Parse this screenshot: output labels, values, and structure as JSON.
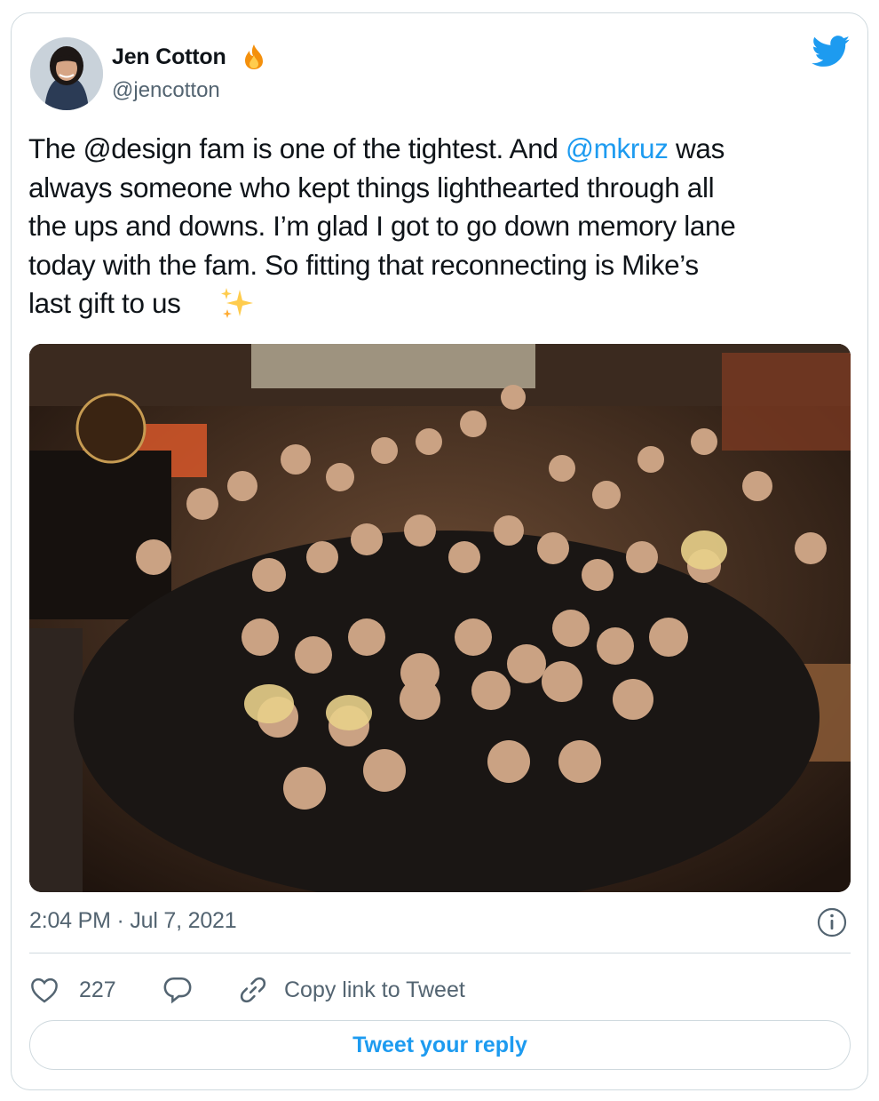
{
  "author": {
    "name": "Jen Cotton",
    "handle": "@jencotton",
    "badge_icon": "fire-icon",
    "avatar_icon": "profile-photo"
  },
  "tweet": {
    "text_part1": "The @design fam is one of the tightest. And ",
    "mention": "@mkruz",
    "text_part2": " was\nalways someone who kept things lighthearted through all\nthe ups and downs. I’m glad I got to go down memory lane\ntoday with the fam. So fitting that reconnecting is Mike’s\nlast gift to us ",
    "emoji_icon": "sparkles-icon",
    "image_icon": "group-photo"
  },
  "meta": {
    "timestamp": "2:04 PM · Jul 7, 2021",
    "info_icon": "info-icon"
  },
  "actions": {
    "like_count": "227",
    "copy_link_label": "Copy link to Tweet"
  },
  "reply_button": {
    "label": "Tweet your reply"
  },
  "colors": {
    "accent": "#1d9bf0",
    "text": "#0f1419",
    "secondary": "#536471",
    "border": "#cfd9de"
  }
}
